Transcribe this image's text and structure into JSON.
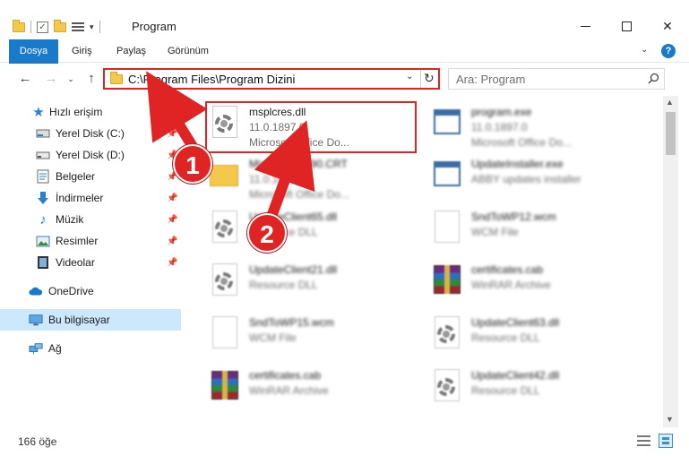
{
  "window": {
    "title": "Program",
    "controls": {
      "minimize": "–",
      "maximize": "□",
      "close": "✕"
    }
  },
  "ribbon": {
    "tabs": [
      {
        "label": "Dosya"
      },
      {
        "label": "Giriş"
      },
      {
        "label": "Paylaş"
      },
      {
        "label": "Görünüm"
      }
    ],
    "help": "?"
  },
  "navigation": {
    "back": "←",
    "forward": "→",
    "recent": "⌄",
    "up": "↑",
    "address": "C:\\Program Files\\Program Dizini",
    "search_placeholder": "Ara: Program"
  },
  "sidebar": {
    "items": [
      {
        "label": "Hızlı erişim",
        "icon": "star-icon"
      },
      {
        "label": "Yerel Disk (C:)",
        "icon": "drive-icon",
        "pinned": true
      },
      {
        "label": "Yerel Disk (D:)",
        "icon": "drive-icon",
        "pinned": true
      },
      {
        "label": "Belgeler",
        "icon": "documents-icon",
        "pinned": true
      },
      {
        "label": "İndirmeler",
        "icon": "download-icon",
        "pinned": true
      },
      {
        "label": "Müzik",
        "icon": "music-icon",
        "pinned": true
      },
      {
        "label": "Resimler",
        "icon": "pictures-icon",
        "pinned": true
      },
      {
        "label": "Videolar",
        "icon": "videos-icon",
        "pinned": true
      },
      {
        "label": "OneDrive",
        "icon": "cloud-icon"
      },
      {
        "label": "Bu bilgisayar",
        "icon": "computer-icon",
        "selected": true
      },
      {
        "label": "Ağ",
        "icon": "network-icon"
      }
    ]
  },
  "files": [
    {
      "name": "msplcres.dll",
      "line1": "11.0.1897.0",
      "line2": "Microsoft Office Do...",
      "icon": "dll-icon",
      "highlighted": true
    },
    {
      "name": "program.exe",
      "line1": "11.0.1897.0",
      "line2": "Microsoft Office Do...",
      "icon": "exe-icon"
    },
    {
      "name": "Microsoft.VC90.CRT",
      "line1": "11.0.1897.0",
      "line2": "Microsoft Office Do...",
      "icon": "folder-icon"
    },
    {
      "name": "UpdateInstaller.exe",
      "line1": "ABBY updates installer",
      "line2": "",
      "icon": "exe-icon"
    },
    {
      "name": "UpdateClient65.dll",
      "line1": "Resource DLL",
      "line2": "",
      "icon": "dll-icon"
    },
    {
      "name": "SndToWP12.wcm",
      "line1": "WCM File",
      "line2": "",
      "icon": "blank-file-icon"
    },
    {
      "name": "UpdateClient21.dll",
      "line1": "Resource DLL",
      "line2": "",
      "icon": "dll-icon"
    },
    {
      "name": "certificates.cab",
      "line1": "WinRAR Archive",
      "line2": "",
      "icon": "winrar-icon"
    },
    {
      "name": "SndToWP15.wcm",
      "line1": "WCM File",
      "line2": "",
      "icon": "blank-file-icon"
    },
    {
      "name": "UpdateClient63.dll",
      "line1": "Resource DLL",
      "line2": "",
      "icon": "dll-icon"
    },
    {
      "name": "certificates.cab",
      "line1": "WinRAR Archive",
      "line2": "",
      "icon": "winrar-icon"
    },
    {
      "name": "UpdateClient42.dll",
      "line1": "Resource DLL",
      "line2": "",
      "icon": "dll-icon"
    }
  ],
  "status": {
    "item_count": "166 öğe"
  },
  "annotations": {
    "badge1": "1",
    "badge2": "2",
    "color": "#e02424"
  },
  "colors": {
    "accent": "#1979ca",
    "selected": "#cce8ff",
    "annotation": "#e02424"
  }
}
